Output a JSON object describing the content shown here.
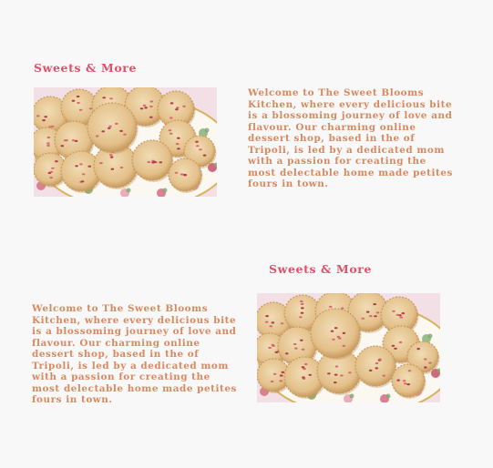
{
  "section1": {
    "title": "Sweets & More",
    "text": "Welcome to The Sweet Blooms Kitchen, where every delicious bite is a blossoming journey of love and flavour. Our charming online dessert shop, based in the of Tripoli, is led by a dedicated mom with a passion for creating the most delectable home made petites fours in town.",
    "image_alt": "Rose petal shortbread cookies on a floral plate"
  },
  "section2": {
    "title": "Sweets & More",
    "text": "Welcome to The Sweet Blooms Kitchen, where every delicious bite is a blossoming journey of love and flavour. Our charming online dessert shop, based in the of Tripoli, is led by a dedicated mom with a passion for creating the most delectable home made petites fours in town.",
    "image_alt": "Rose petal shortbread cookies on a floral plate"
  },
  "colors": {
    "heading": "#e0506a",
    "body_text": "#d9895f",
    "background": "#f8f8f8"
  }
}
